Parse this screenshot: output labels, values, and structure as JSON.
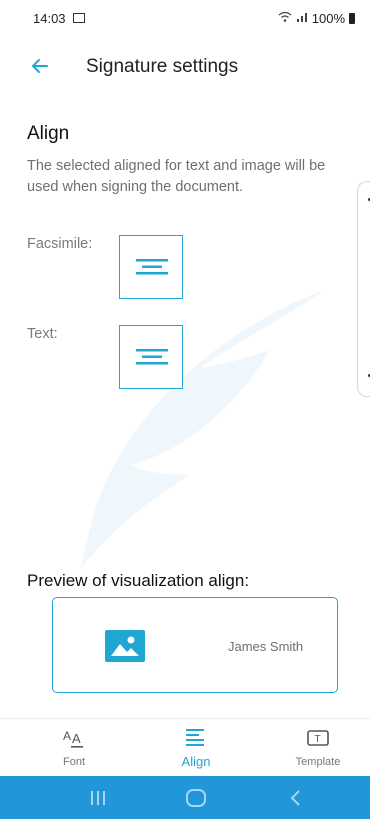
{
  "status": {
    "time": "14:03",
    "battery": "100%"
  },
  "header": {
    "title": "Signature settings"
  },
  "section": {
    "title": "Align",
    "description": "The selected aligned for text and image will be used when signing the document."
  },
  "rows": {
    "facsimile_label": "Facsimile:",
    "text_label": "Text:"
  },
  "preview": {
    "title": "Preview of visualization align:",
    "name": "James Smith"
  },
  "nav": {
    "items": [
      {
        "label": "Font",
        "icon": "font-icon"
      },
      {
        "label": "Align",
        "icon": "align-center-icon"
      },
      {
        "label": "Template",
        "icon": "template-icon"
      }
    ],
    "active": "Align"
  },
  "colors": {
    "accent": "#20a6d3",
    "system_bar": "#2196d8"
  }
}
